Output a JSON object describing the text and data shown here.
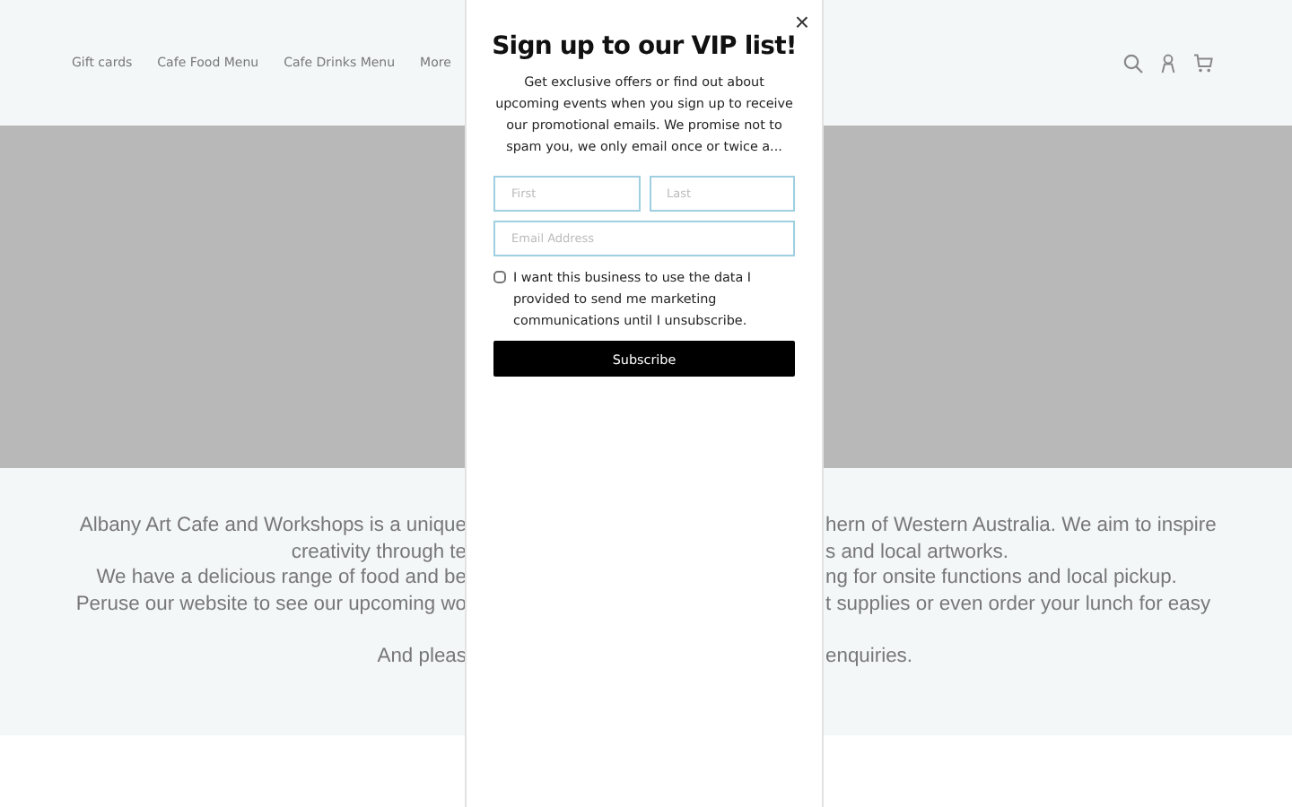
{
  "nav": {
    "links": [
      "Gift cards",
      "Cafe Food Menu",
      "Cafe Drinks Menu",
      "More"
    ]
  },
  "about": {
    "lines": [
      {
        "left": "Albany Art Cafe and Workshops is a unique",
        "right": "hern of Western Australia. We aim to inspire"
      },
      {
        "left": "creativity through te",
        "right": "s and local artworks."
      },
      {
        "left": "We have a delicious range of food and be",
        "right": "ng for onsite functions and local pickup."
      },
      {
        "left": "Peruse our website to see our upcoming wo",
        "right": "t supplies or even order your lunch for easy"
      },
      {
        "left": "And pleas",
        "right": "enquiries.",
        "gap_before": true
      }
    ]
  },
  "popup": {
    "close": "×",
    "title": "Sign up to our VIP list!",
    "description": "Get exclusive offers or find out about upcoming events when you sign up to receive our promotional emails. We promise not to spam you, we only email once or twice a...",
    "first": {
      "placeholder": "First"
    },
    "last": {
      "placeholder": "Last"
    },
    "email": {
      "placeholder": "Email Address"
    },
    "consent": {
      "label": "I want this business to use the data I provided to send me marketing communications until I unsubscribe.",
      "checked": false
    },
    "button": "Subscribe"
  }
}
